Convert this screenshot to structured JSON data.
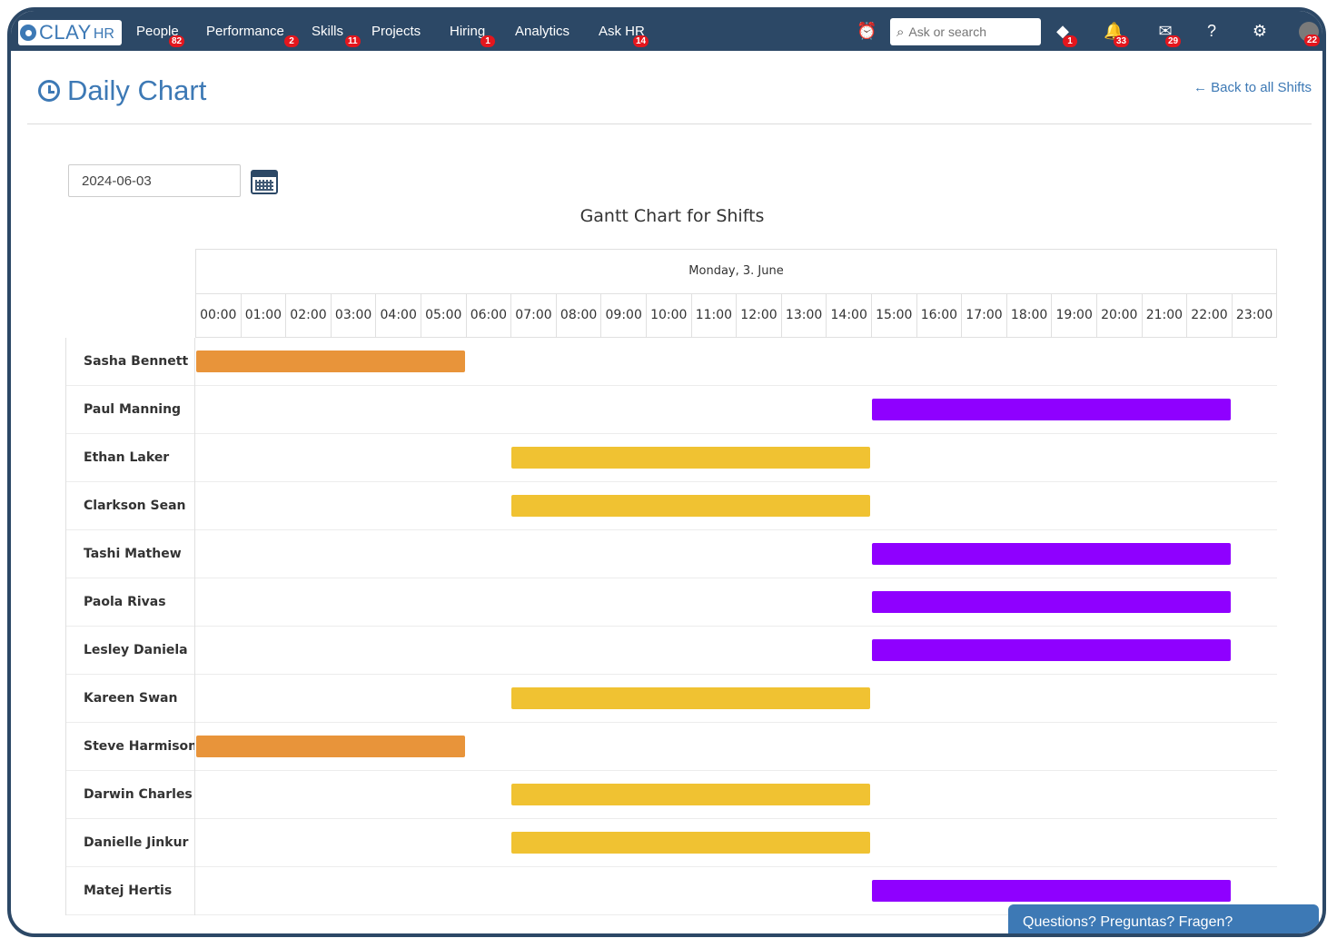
{
  "nav": {
    "logo_text": "CLAY",
    "logo_sub": "HR",
    "items": [
      {
        "label": "People",
        "badge": "82"
      },
      {
        "label": "Performance",
        "badge": "2"
      },
      {
        "label": "Skills",
        "badge": "11"
      },
      {
        "label": "Projects",
        "badge": ""
      },
      {
        "label": "Hiring",
        "badge": "1"
      },
      {
        "label": "Analytics",
        "badge": ""
      },
      {
        "label": "Ask HR",
        "badge": "14"
      }
    ],
    "search_placeholder": "Ask or search",
    "icons": [
      {
        "name": "alarm-clock-icon",
        "glyph": "⏰",
        "badge": ""
      },
      {
        "name": "stack-icon",
        "glyph": "◆",
        "badge": "1"
      },
      {
        "name": "bell-icon",
        "glyph": "🔔",
        "badge": "33"
      },
      {
        "name": "mail-icon",
        "glyph": "✉",
        "badge": "29"
      },
      {
        "name": "help-icon",
        "glyph": "?",
        "badge": ""
      },
      {
        "name": "gear-icon",
        "glyph": "⚙",
        "badge": ""
      }
    ],
    "avatar_badge": "22"
  },
  "page": {
    "title": "Daily Chart",
    "back_link": "← Back to all Shifts",
    "date_value": "2024-06-03"
  },
  "chart_data": {
    "type": "gantt",
    "title": "Gantt Chart for Shifts",
    "date_label": "Monday, 3. June",
    "hours": [
      "00:00",
      "01:00",
      "02:00",
      "03:00",
      "04:00",
      "05:00",
      "06:00",
      "07:00",
      "08:00",
      "09:00",
      "10:00",
      "11:00",
      "12:00",
      "13:00",
      "14:00",
      "15:00",
      "16:00",
      "17:00",
      "18:00",
      "19:00",
      "20:00",
      "21:00",
      "22:00",
      "23:00"
    ],
    "rows": [
      {
        "name": "Sasha Bennett",
        "start": 0,
        "end": 6,
        "color": "#e8943a"
      },
      {
        "name": "Paul Manning",
        "start": 15,
        "end": 23,
        "color": "#8f00ff"
      },
      {
        "name": "Ethan Laker",
        "start": 7,
        "end": 15,
        "color": "#f0c232"
      },
      {
        "name": "Clarkson Sean",
        "start": 7,
        "end": 15,
        "color": "#f0c232"
      },
      {
        "name": "Tashi Mathew",
        "start": 15,
        "end": 23,
        "color": "#8f00ff"
      },
      {
        "name": "Paola Rivas",
        "start": 15,
        "end": 23,
        "color": "#8f00ff"
      },
      {
        "name": "Lesley Daniela",
        "start": 15,
        "end": 23,
        "color": "#8f00ff"
      },
      {
        "name": "Kareen Swan",
        "start": 7,
        "end": 15,
        "color": "#f0c232"
      },
      {
        "name": "Steve Harmison",
        "start": 0,
        "end": 6,
        "color": "#e8943a"
      },
      {
        "name": "Darwin Charles",
        "start": 7,
        "end": 15,
        "color": "#f0c232"
      },
      {
        "name": "Danielle Jinkur",
        "start": 7,
        "end": 15,
        "color": "#f0c232"
      },
      {
        "name": "Matej Hertis",
        "start": 15,
        "end": 23,
        "color": "#8f00ff"
      }
    ]
  },
  "help_button": "Questions? Preguntas? Fragen?"
}
